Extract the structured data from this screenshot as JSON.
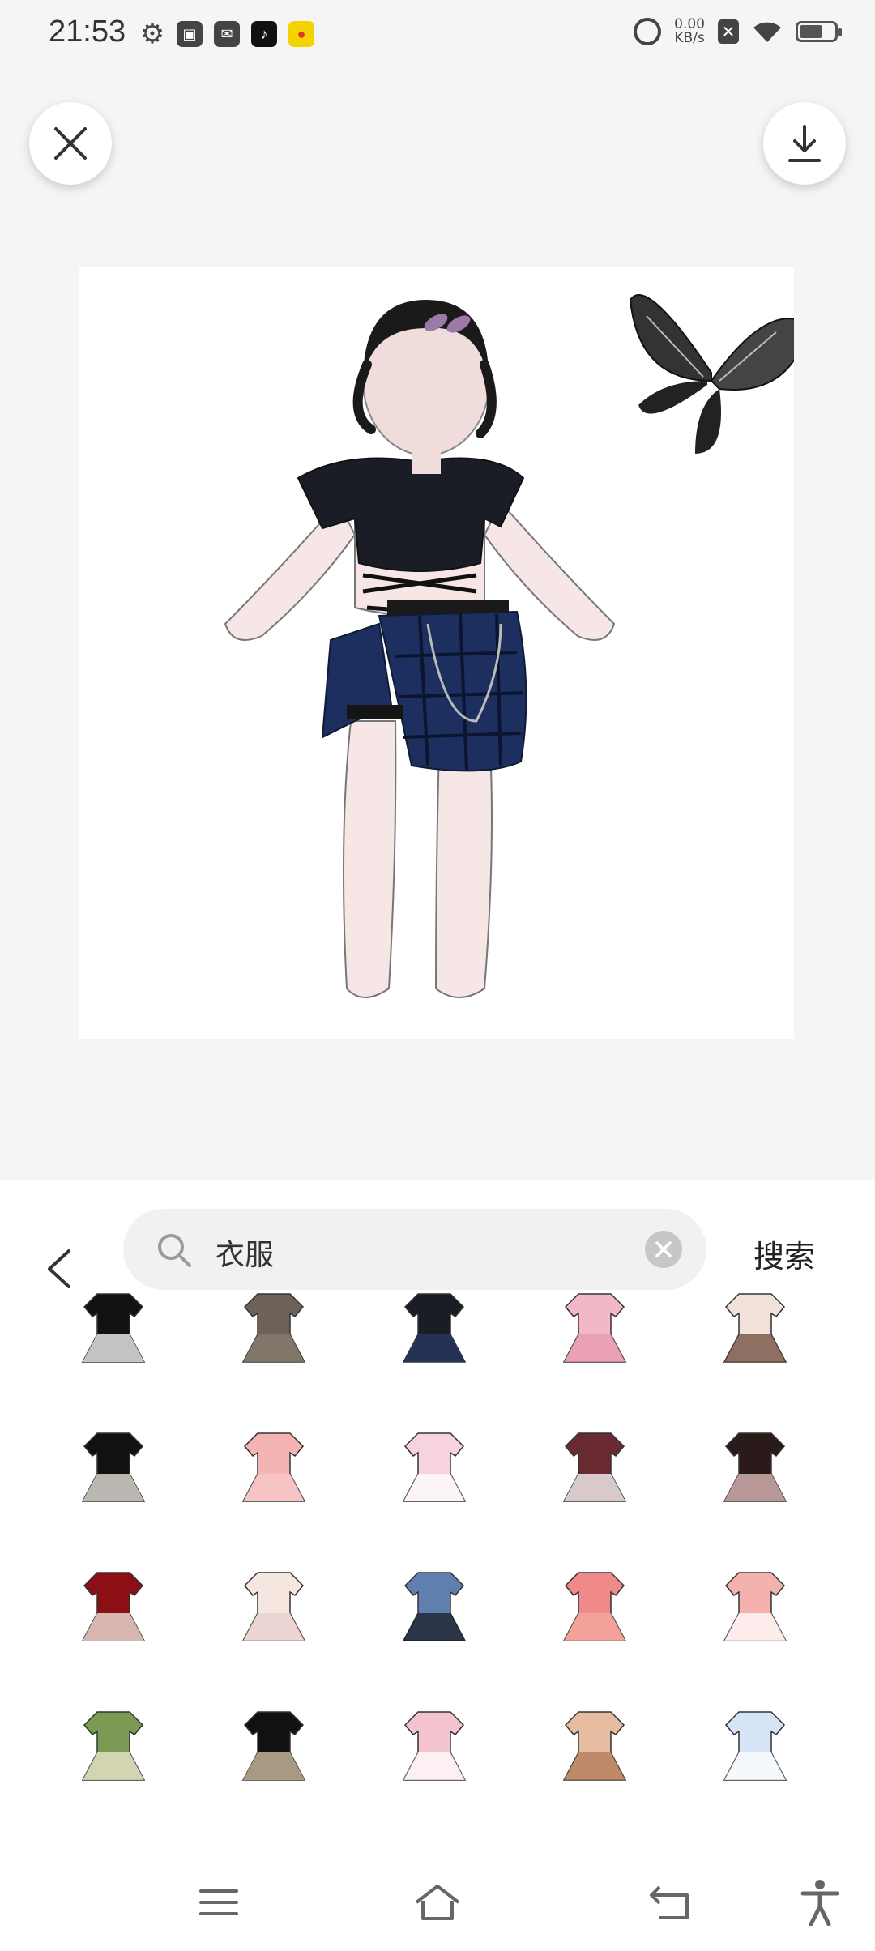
{
  "status_bar": {
    "time": "21:53",
    "speed_value": "0.00",
    "speed_unit": "KB/s",
    "icons_left": [
      "gear-icon",
      "app-icon",
      "app-icon",
      "tiktok-icon",
      "app-icon"
    ],
    "icons_right": [
      "alarm-icon",
      "sim-off-icon",
      "wifi-icon",
      "battery-icon"
    ]
  },
  "toolbar": {
    "close_icon": "close-icon",
    "download_icon": "download-icon"
  },
  "search": {
    "query": "衣服",
    "action_label": "搜索"
  },
  "items": [
    "checkered-jacket",
    "brown-cardigan",
    "black-crop-outfit",
    "pink-skirt",
    "beige-coat",
    "black-white-dress",
    "pink-mini-skirt",
    "pink-frilly-dress",
    "maid-dress",
    "black-floral-dress",
    "red-santa-skirt",
    "lace-dress",
    "denim-overall-dress",
    "pink-gown",
    "pink-white-dress",
    "green-jacket",
    "black-cape-top",
    "pink-outfit",
    "tan-dress",
    "blue-lolita-dress"
  ],
  "colors": {
    "sheet_bg": "#ffffff",
    "page_bg": "#f5f5f5",
    "search_bg": "#f1f1f1",
    "accent_dark": "#222222"
  }
}
